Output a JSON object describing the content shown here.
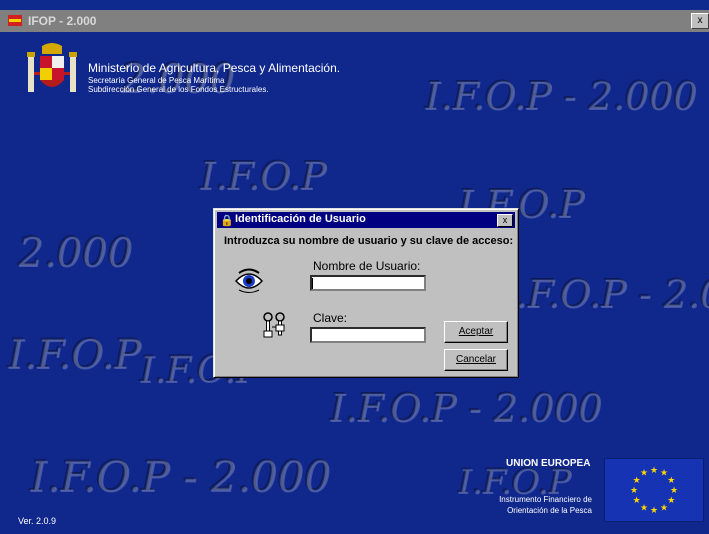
{
  "window": {
    "title": "IFOP - 2.000",
    "close_glyph": "x"
  },
  "watermark_texts": [
    "I.F.O.P - 2.000",
    "I.F.O.P",
    "2.000",
    "I.F.O.P - 2.000"
  ],
  "header": {
    "ministry_title": "Ministerio de Agricultura, Pesca y Alimentación.",
    "sub1": "Secretaría General de Pesca Marítima",
    "sub2": "Subdirección General de los Fondos Estructurales."
  },
  "dialog": {
    "title": "Identificación de Usuario",
    "close_glyph": "x",
    "prompt": "Introduzca su nombre de usuario y su clave de acceso:",
    "user_label": "Nombre de Usuario:",
    "user_value": "",
    "pass_label": "Clave:",
    "pass_value": "",
    "ok_label": "Aceptar",
    "cancel_label": "Cancelar"
  },
  "footer": {
    "eu_title": "UNION EUROPEA",
    "eu_line1": "Instrumento Financiero de",
    "eu_line2": "Orientación de la Pesca",
    "version": "Ver. 2.0.9"
  },
  "colors": {
    "desktop": "#10278c",
    "dialog_titlebar": "#000080",
    "window_titlebar": "#808080",
    "eu_flag": "#1533b3",
    "eu_star": "#ffd400"
  }
}
